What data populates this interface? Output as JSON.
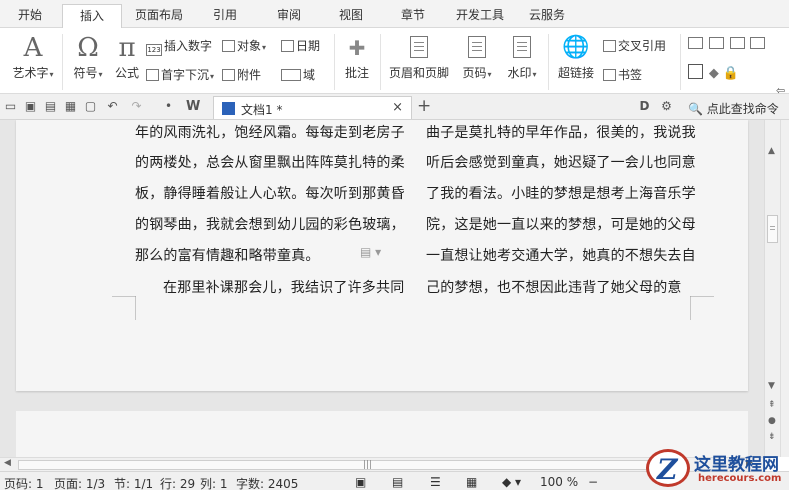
{
  "menu": {
    "tabs": [
      "开始",
      "插入",
      "页面布局",
      "引用",
      "审阅",
      "视图",
      "章节",
      "开发工具",
      "云服务"
    ],
    "active_tab": "插入"
  },
  "ribbon": {
    "art_text": "艺术字",
    "symbol": "符号",
    "formula": "公式",
    "insert_number": "插入数字",
    "object": "对象",
    "date": "日期",
    "drop_cap": "首字下沉",
    "attachment": "附件",
    "field": "域",
    "comment": "批注",
    "header_footer": "页眉和页脚",
    "page_number": "页码",
    "watermark": "水印",
    "hyperlink": "超链接",
    "cross_reference": "交叉引用",
    "bookmark": "书签"
  },
  "quickbar": {
    "document_tab": "文档1 *",
    "find_command": "点此查找命令"
  },
  "document": {
    "left_column": [
      "年的风雨洗礼，饱经风霜。每每走到老房子",
      "的两楼处，总会从窗里飘出阵阵莫扎特的柔",
      "板，静得睡着般让人心软。每次听到那黄昏",
      "的钢琴曲，我就会想到幼儿园的彩色玻璃，",
      "那么的富有情趣和略带童真。",
      "在那里补课那会儿，我结识了许多共同"
    ],
    "right_column": [
      "曲子是莫扎特的早年作品，很美的，我说我",
      "听后会感觉到童真，她迟疑了一会儿也同意",
      "了我的看法。小眭的梦想是想考上海音乐学",
      "院，这是她一直以来的梦想，可是她的父母",
      "一直想让她考交通大学，她真的不想失去自",
      "己的梦想，也不想因此违背了她父母的意"
    ]
  },
  "status": {
    "page": "页码: 1",
    "pages": "页面: 1/3",
    "section": "节: 1/1",
    "row": "行: 29",
    "column": "列: 1",
    "word_count": "字数: 2405",
    "zoom": "100 %"
  },
  "watermark": {
    "logo_letter": "Z",
    "site_name": "这里教程网",
    "site_url": "herecours.com"
  }
}
